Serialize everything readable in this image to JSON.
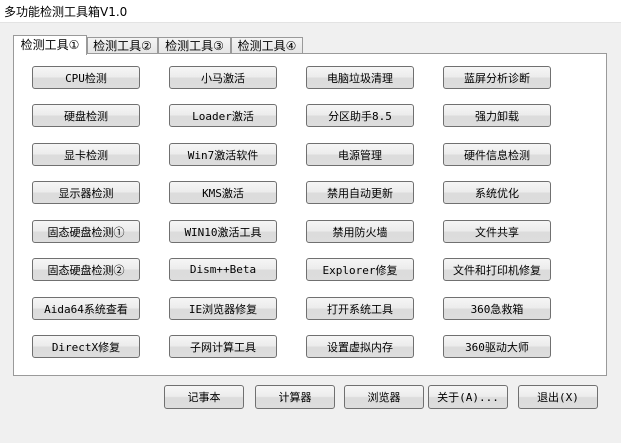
{
  "window": {
    "title": "多功能检测工具箱V1.0"
  },
  "tabs": [
    {
      "label": "检测工具①"
    },
    {
      "label": "检测工具②"
    },
    {
      "label": "检测工具③"
    },
    {
      "label": "检测工具④"
    }
  ],
  "tools": [
    [
      "CPU检测",
      "小马激活",
      "电脑垃圾清理",
      "蓝屏分析诊断"
    ],
    [
      "硬盘检测",
      "Loader激活",
      "分区助手8.5",
      "强力卸载"
    ],
    [
      "显卡检测",
      "Win7激活软件",
      "电源管理",
      "硬件信息检测"
    ],
    [
      "显示器检测",
      "KMS激活",
      "禁用自动更新",
      "系统优化"
    ],
    [
      "固态硬盘检测①",
      "WIN10激活工具",
      "禁用防火墙",
      "文件共享"
    ],
    [
      "固态硬盘检测②",
      "Dism++Beta",
      "Explorer修复",
      "文件和打印机修复"
    ],
    [
      "Aida64系统查看",
      "IE浏览器修复",
      "打开系统工具",
      "360急救箱"
    ],
    [
      "DirectX修复",
      "子网计算工具",
      "设置虚拟内存",
      "360驱动大师"
    ]
  ],
  "bottom_buttons": [
    "记事本",
    "计算器",
    "浏览器",
    "关于(A)...",
    "退出(X)"
  ]
}
